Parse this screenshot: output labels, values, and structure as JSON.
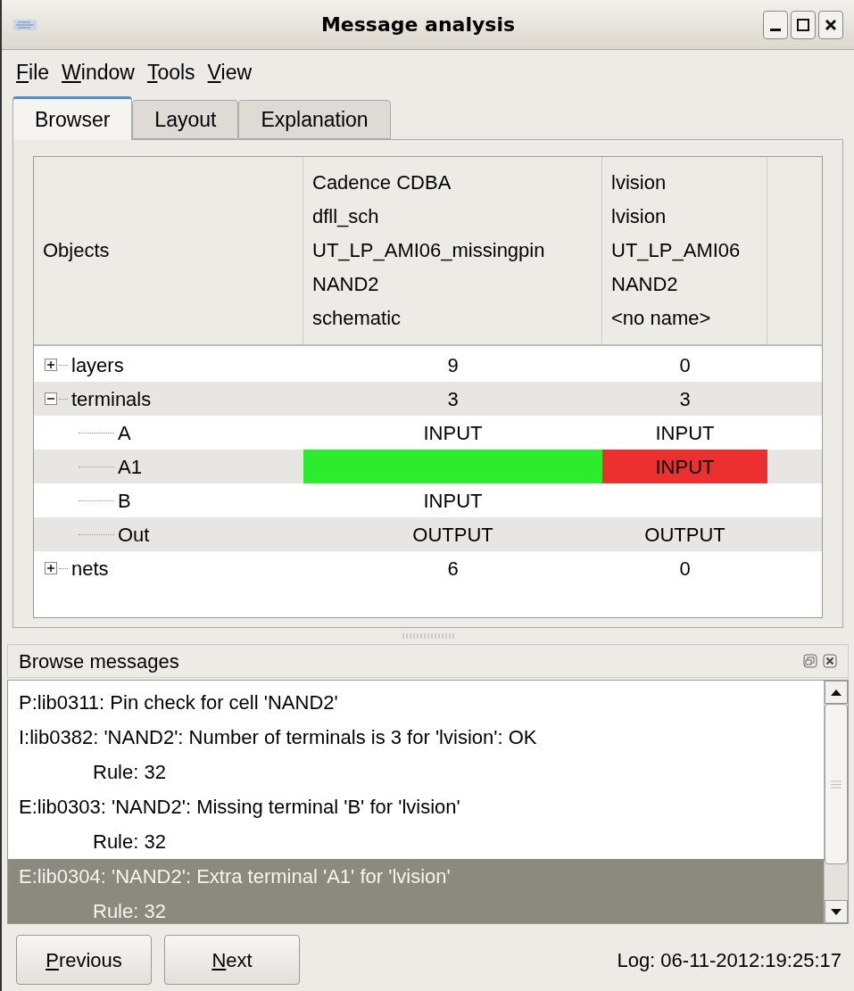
{
  "window": {
    "title": "Message analysis"
  },
  "menu": [
    {
      "label": "File",
      "mnemonic_underlined": true
    },
    {
      "label": "Window",
      "mnemonic_underlined": true
    },
    {
      "label": "Tools",
      "mnemonic_underlined": true
    },
    {
      "label": "View",
      "mnemonic_underlined": true
    }
  ],
  "tabs": [
    {
      "label": "Browser",
      "selected": true
    },
    {
      "label": "Layout",
      "selected": false
    },
    {
      "label": "Explanation",
      "selected": false
    }
  ],
  "table": {
    "columns": [
      {
        "lines": [
          "Objects"
        ]
      },
      {
        "lines": [
          "Cadence CDBA",
          "dfll_sch",
          "UT_LP_AMI06_missingpin",
          "NAND2",
          "schematic"
        ]
      },
      {
        "lines": [
          "lvision",
          "lvision",
          "UT_LP_AMI06",
          "NAND2",
          "<no name>"
        ]
      }
    ],
    "rows": [
      {
        "expanded": false,
        "cells": [
          {
            "text": "layers"
          },
          {
            "text": "9"
          },
          {
            "text": "0"
          }
        ]
      },
      {
        "expanded": true,
        "cells": [
          {
            "text": "terminals"
          },
          {
            "text": "3"
          },
          {
            "text": "3"
          }
        ],
        "children": [
          {
            "cells": [
              {
                "text": "A"
              },
              {
                "text": "INPUT"
              },
              {
                "text": "INPUT"
              }
            ]
          },
          {
            "cells": [
              {
                "text": "A1"
              },
              {
                "color": "#2deb2d"
              },
              {
                "text": "INPUT",
                "color": "#ec3030"
              }
            ]
          },
          {
            "cells": [
              {
                "text": "B"
              },
              {
                "text": "INPUT"
              },
              {}
            ]
          },
          {
            "cells": [
              {
                "text": "Out"
              },
              {
                "text": "OUTPUT"
              },
              {
                "text": "OUTPUT"
              }
            ]
          }
        ]
      },
      {
        "expanded": false,
        "cells": [
          {
            "text": "nets"
          },
          {
            "text": "6"
          },
          {
            "text": "0"
          }
        ]
      }
    ]
  },
  "messages_panel": {
    "title": "Browse messages",
    "messages": [
      {
        "text": "P:lib0311: Pin check for cell 'NAND2'",
        "selected": false
      },
      {
        "text": "I:lib0382: 'NAND2': Number of terminals is 3 for 'lvision': OK",
        "selected": false,
        "details": [
          "Rule: 32"
        ]
      },
      {
        "text": "E:lib0303: 'NAND2': Missing terminal 'B' for 'lvision'",
        "selected": false,
        "details": [
          "Rule: 32"
        ]
      },
      {
        "text": "E:lib0304: 'NAND2': Extra terminal 'A1' for 'lvision'",
        "selected": true,
        "details": [
          "Rule: 32"
        ]
      }
    ]
  },
  "buttons": [
    {
      "label": "Previous",
      "mnemonic_underlined": true
    },
    {
      "label": "Next",
      "mnemonic_underlined": true
    }
  ],
  "status": "Log: 06-11-2012:19:25:17"
}
